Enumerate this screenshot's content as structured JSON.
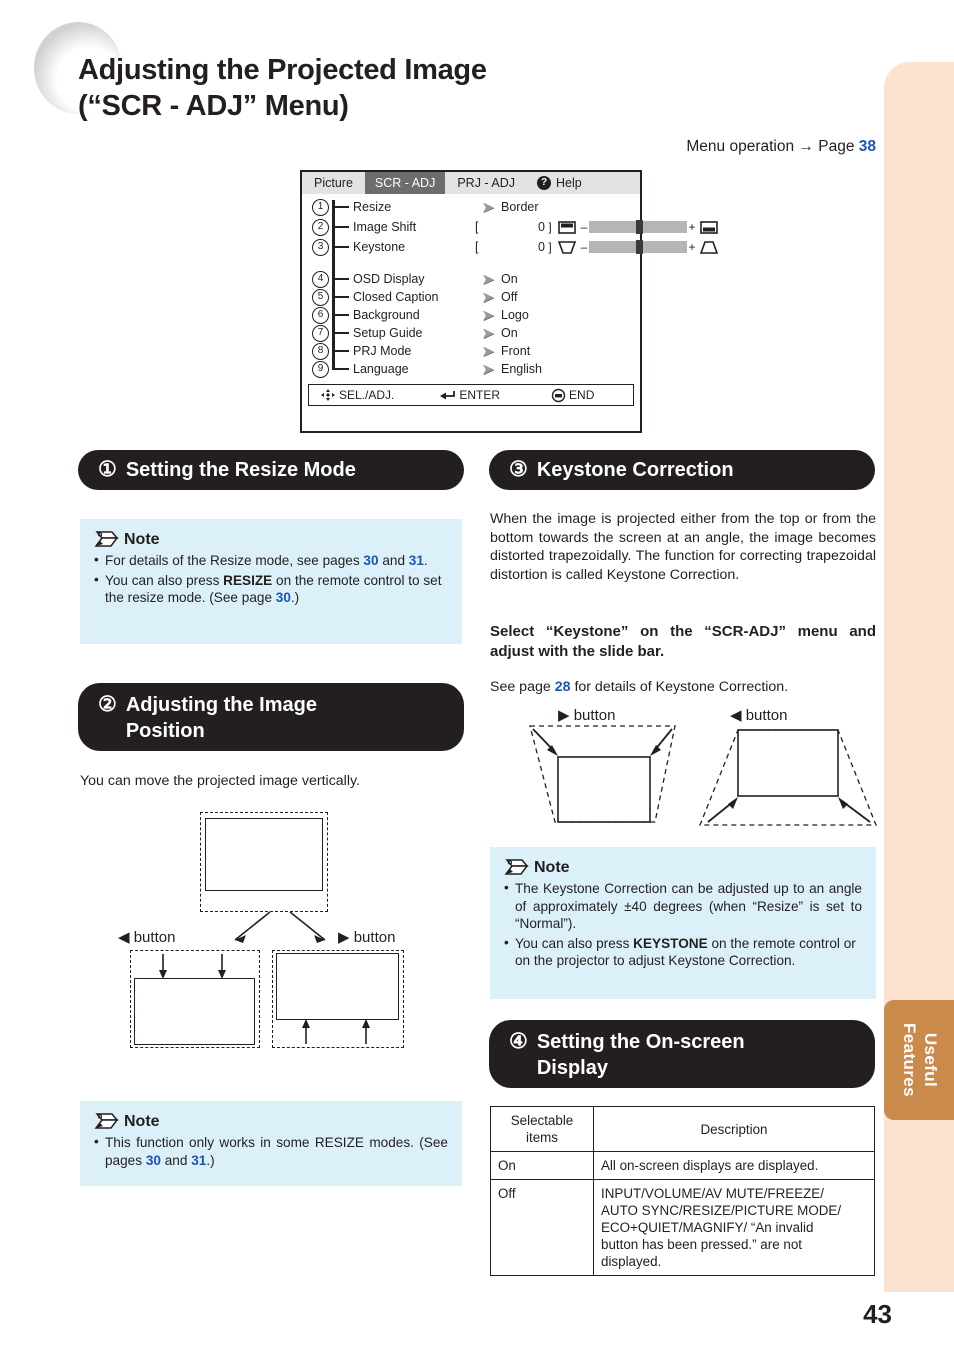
{
  "page": {
    "title_line1": "Adjusting the Projected Image",
    "title_line2": "(“SCR - ADJ” Menu)",
    "menu_operation_label": "Menu operation",
    "menu_operation_arrow": "→",
    "menu_operation_page_word": "Page",
    "menu_operation_page_num": "38",
    "page_number": "43",
    "side_tab_line1": "Useful",
    "side_tab_line2": "Features",
    "accent_blue": "#1b55b5",
    "side_tab_color": "#c98a4b",
    "note_bg_color": "#dcf0fa",
    "peach_color": "#fce3d0"
  },
  "osd": {
    "tabs": [
      {
        "label": "Picture",
        "active": false
      },
      {
        "label": "SCR - ADJ",
        "active": true
      },
      {
        "label": "PRJ - ADJ",
        "active": false
      }
    ],
    "help_icon_glyph": "?",
    "help_label": "Help",
    "rows": [
      {
        "num": "1",
        "label": "Resize",
        "type": "arrow",
        "value": "Border"
      },
      {
        "num": "2",
        "label": "Image Shift",
        "type": "slider",
        "bracket_open": "[",
        "value": "0",
        "bracket_close": "]",
        "minus": "–",
        "plus": "+"
      },
      {
        "num": "3",
        "label": "Keystone",
        "type": "slider",
        "bracket_open": "[",
        "value": "0",
        "bracket_close": "]",
        "minus": "–",
        "plus": "+"
      },
      {
        "num": "4",
        "label": "OSD Display",
        "type": "arrow",
        "value": "On"
      },
      {
        "num": "5",
        "label": "Closed Caption",
        "type": "arrow",
        "value": "Off"
      },
      {
        "num": "6",
        "label": "Background",
        "type": "arrow",
        "value": "Logo"
      },
      {
        "num": "7",
        "label": "Setup Guide",
        "type": "arrow",
        "value": "On"
      },
      {
        "num": "8",
        "label": "PRJ Mode",
        "type": "arrow",
        "value": "Front"
      },
      {
        "num": "9",
        "label": "Language",
        "type": "arrow",
        "value": "English"
      }
    ],
    "footer": {
      "sel_adj": "SEL./ADJ.",
      "enter": "ENTER",
      "end": "END"
    }
  },
  "section1": {
    "number": "①",
    "heading": "Setting the Resize Mode",
    "note_label": "Note",
    "bullets": [
      "For details of the Resize mode, see pages 30 and 31.",
      "You can also press RESIZE on the remote control to set the resize mode. (See page 30.)"
    ]
  },
  "section2": {
    "number": "②",
    "heading_line1": "Adjusting the Image",
    "heading_line2": "Position",
    "intro": "You can move the projected image vertically.",
    "left_button_label": "button",
    "left_button_glyph": "◀",
    "right_button_label": "button",
    "right_button_glyph": "▶",
    "note_label": "Note",
    "bullets": [
      "This function only works in some RESIZE modes. (See pages 30 and 31.)"
    ]
  },
  "section3": {
    "number": "③",
    "heading": "Keystone Correction",
    "paragraph": "When the image is projected either from the top or from the bottom towards the screen at an angle, the image becomes distorted trapezoidally. The function for correcting trapezoidal distortion is called Keystone Correction.",
    "bold_lead": "Select “Keystone” on the “SCR-ADJ” menu and adjust with the slide bar.",
    "see_page_prefix": "See page",
    "see_page_num": "28",
    "see_page_suffix": "for details of Keystone Correction.",
    "right_button_glyph": "▶",
    "right_button_label": "button",
    "left_button_glyph": "◀",
    "left_button_label": "button",
    "note_label": "Note",
    "bullets": [
      "The Keystone Correction can be adjusted up to an angle of approximately ±40 degrees (when “Resize” is set to “Normal”).",
      "You can also press KEYSTONE on the remote control or on the projector to adjust Keystone Correction."
    ]
  },
  "section4": {
    "number": "④",
    "heading_line1": "Setting the On-screen",
    "heading_line2": "Display",
    "table": {
      "headers": [
        "Selectable items",
        "Description"
      ],
      "header_col1_line1": "Selectable",
      "header_col1_line2": "items",
      "rows": [
        {
          "item": "On",
          "description": "All on-screen displays are displayed."
        },
        {
          "item": "Off",
          "description": "INPUT/VOLUME/AV MUTE/FREEZE/ AUTO SYNC/RESIZE/PICTURE MODE/ ECO+QUIET/MAGNIFY/ “An invalid button has been pressed.” are not displayed."
        }
      ]
    }
  }
}
